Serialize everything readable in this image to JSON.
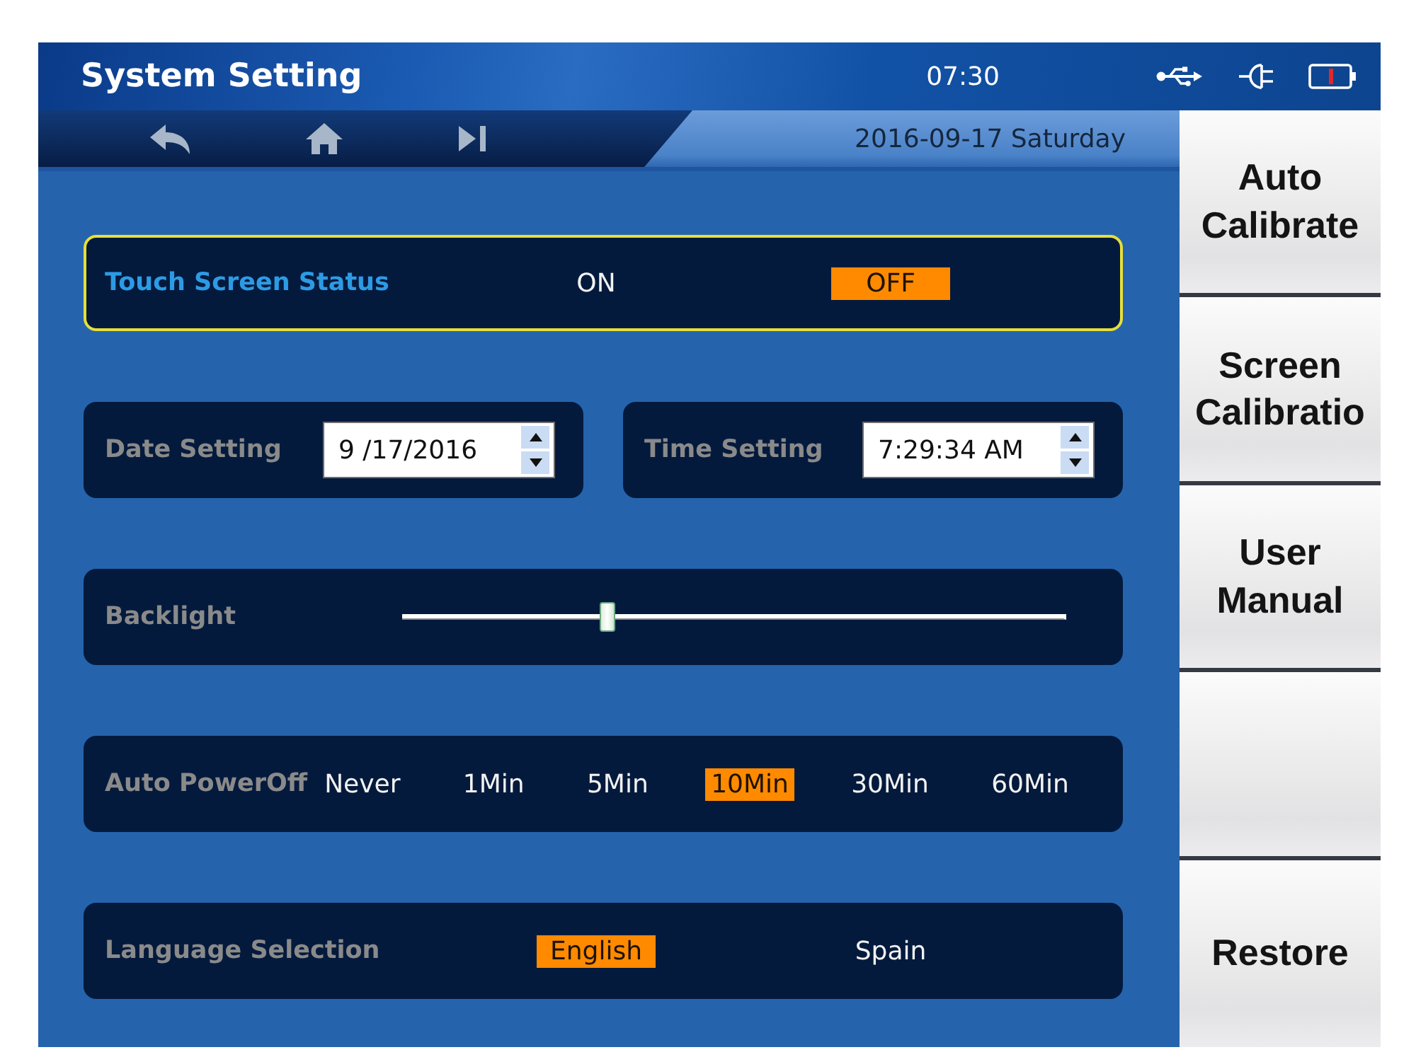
{
  "header": {
    "title": "System Setting",
    "time": "07:30",
    "date": "2016-09-17 Saturday"
  },
  "settings": [
    {
      "kind": "pair",
      "label": "Touch Screen Status",
      "focused": true,
      "options": [
        {
          "label": "ON",
          "selected": false
        },
        {
          "label": "OFF",
          "selected": true
        }
      ]
    },
    {
      "kind": "fields",
      "focused": false,
      "fields": [
        {
          "label": "Date Setting",
          "value": "9 /17/2016"
        },
        {
          "label": "Time Setting",
          "value": "7:29:34 AM"
        }
      ]
    },
    {
      "kind": "slider",
      "label": "Backlight",
      "focused": false,
      "level": 0.31
    },
    {
      "kind": "row",
      "label": "Auto PowerOff",
      "focused": false,
      "options": [
        {
          "label": "Never",
          "selected": false
        },
        {
          "label": "1Min",
          "selected": false
        },
        {
          "label": "5Min",
          "selected": false
        },
        {
          "label": "10Min",
          "selected": true
        },
        {
          "label": "30Min",
          "selected": false
        },
        {
          "label": "60Min",
          "selected": false
        }
      ]
    },
    {
      "kind": "pair",
      "label": "Language Selection",
      "focused": false,
      "options": [
        {
          "label": "English",
          "selected": true
        },
        {
          "label": "Spain",
          "selected": false
        }
      ]
    }
  ],
  "sidebar": {
    "buttons": [
      {
        "kind": "labeled",
        "label": "Auto Calibrate"
      },
      {
        "kind": "labeled",
        "label": "Screen Calibratio"
      },
      {
        "kind": "labeled",
        "label": "User Manual"
      },
      {
        "kind": "blank"
      },
      {
        "kind": "labeled",
        "label": "Restore"
      }
    ]
  }
}
